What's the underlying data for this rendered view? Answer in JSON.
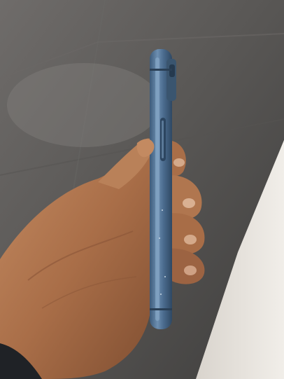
{
  "scene": {
    "subject": "blue-smartphone-side-view-in-hand",
    "colors": {
      "floor_dark": "#4f4d4c",
      "floor_light": "#7a7673",
      "wall": "#e7e3dd",
      "phone_blue": "#4d6f92",
      "phone_highlight": "#8fb0cf",
      "skin": "#b77a52",
      "skin_shadow": "#7c4a2e",
      "purple_glow": "#b04fc8",
      "strap": "#1f2226"
    }
  }
}
